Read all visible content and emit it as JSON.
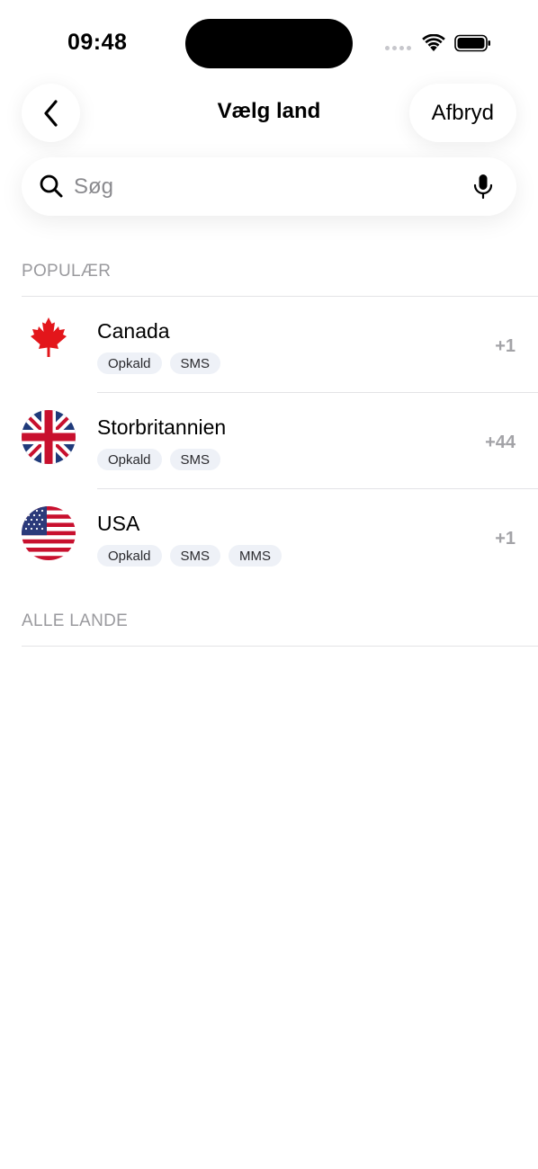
{
  "status_bar": {
    "time": "09:48"
  },
  "header": {
    "title": "Vælg land",
    "cancel_label": "Afbryd",
    "back_icon": "chevron-left-icon"
  },
  "search": {
    "placeholder": "Søg",
    "value": "",
    "search_icon": "search-icon",
    "mic_icon": "microphone-icon"
  },
  "sections": {
    "popular": "POPULÆR",
    "all": "ALLE LANDE"
  },
  "countries": [
    {
      "name": "Canada",
      "code": "+1",
      "flag_icon": "canada-flag-icon",
      "tags": [
        "Opkald",
        "SMS"
      ]
    },
    {
      "name": "Storbritannien",
      "code": "+44",
      "flag_icon": "uk-flag-icon",
      "tags": [
        "Opkald",
        "SMS"
      ]
    },
    {
      "name": "USA",
      "code": "+1",
      "flag_icon": "usa-flag-icon",
      "tags": [
        "Opkald",
        "SMS",
        "MMS"
      ]
    }
  ],
  "colors": {
    "tag_background": "#eef1f7",
    "section_text": "#9a9a9e",
    "dial_code": "#a3a3a7",
    "canada_red": "#e3161b",
    "uk_blue": "#1f3a7a",
    "uk_red": "#c8102e"
  }
}
